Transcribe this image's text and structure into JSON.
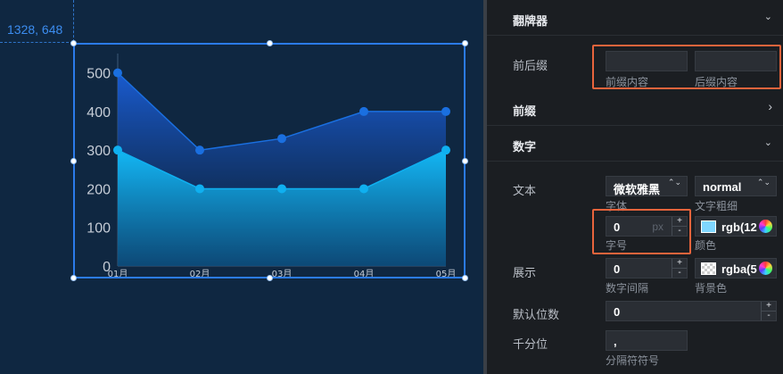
{
  "canvas": {
    "coords": "1328, 648"
  },
  "chart_data": {
    "type": "area",
    "categories": [
      "01月",
      "02月",
      "03月",
      "04月",
      "05月"
    ],
    "series": [
      {
        "values": [
          500,
          300,
          330,
          400,
          400
        ],
        "color": "#1a6fe0"
      },
      {
        "values": [
          300,
          200,
          200,
          200,
          300
        ],
        "color": "#0fb0f0"
      }
    ],
    "y_ticks": [
      0,
      100,
      200,
      300,
      400,
      500
    ],
    "ylim": [
      0,
      550
    ],
    "grid": false
  },
  "panel": {
    "flipper_section": "翻牌器",
    "prefix_suffix": {
      "label": "前后缀",
      "prefix_caption": "前缀内容",
      "suffix_caption": "后缀内容",
      "prefix_value": "",
      "suffix_value": ""
    },
    "prefix_section": "前缀",
    "number_section": "数字",
    "text": {
      "label": "文本",
      "font_value": "微软雅黑",
      "font_caption": "字体",
      "weight_value": "normal",
      "weight_caption": "文字粗细",
      "size_value": "0",
      "size_unit": "px",
      "size_caption": "字号",
      "color_value": "rgb(12",
      "color_swatch": "#7fd6ff",
      "color_caption": "颜色"
    },
    "display": {
      "label": "展示",
      "spacing_value": "0",
      "spacing_caption": "数字间隔",
      "bg_value": "rgba(5",
      "bg_caption": "背景色"
    },
    "decimals": {
      "label": "默认位数",
      "value": "0"
    },
    "thousands": {
      "label": "千分位",
      "value": ",",
      "caption": "分隔符符号"
    },
    "stepper_up": "+",
    "stepper_down": "-",
    "select_arrows": "⌃⌄",
    "chevron_down": "⌄",
    "chevron_right": "›"
  }
}
